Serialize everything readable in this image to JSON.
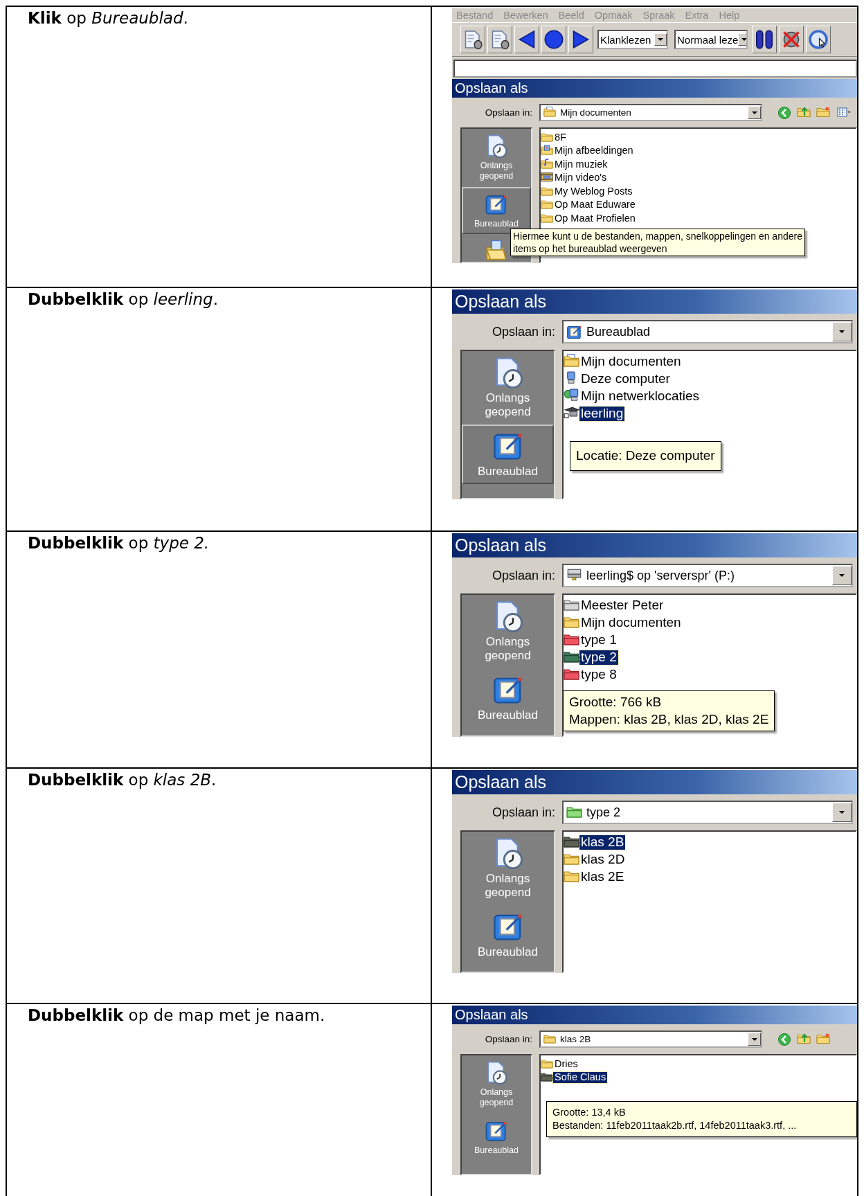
{
  "steps": [
    {
      "instruction": "**Klik** op *Bureaublad*.",
      "screenshot": {
        "kind": "compact",
        "menu": [
          "Bestand",
          "Bewerken",
          "Beeld",
          "Opmaak",
          "Spraak",
          "Extra",
          "Help"
        ],
        "toolbar": [
          {
            "kind": "speaker"
          },
          {
            "kind": "speaker"
          },
          {
            "kind": "prev"
          },
          {
            "kind": "stop"
          },
          {
            "kind": "next"
          },
          {
            "kind": "dropdown",
            "value": "Klanklezen"
          },
          {
            "kind": "dropdown",
            "value": "Normaal leze"
          },
          {
            "kind": "pause"
          },
          {
            "kind": "mute"
          },
          {
            "kind": "clock"
          }
        ],
        "text_field": true,
        "title": "Opslaan als",
        "location_label": "Opslaan in:",
        "location": {
          "name": "Mijn documenten",
          "kind": "documents"
        },
        "nav_buttons": [
          {
            "kind": "back"
          },
          {
            "kind": "up"
          },
          {
            "kind": "newfolder"
          },
          {
            "kind": "views"
          }
        ],
        "places": [
          {
            "label": "Onlangs geopend",
            "kind": "recent",
            "selected": false
          },
          {
            "label": "Bureaublad",
            "kind": "desktop",
            "selected": true
          },
          {
            "kind": "openfolder",
            "selected": false
          }
        ],
        "files": [
          {
            "name": "8F",
            "kind": "folder",
            "selected": false
          },
          {
            "name": "Mijn afbeeldingen",
            "kind": "pictures",
            "selected": false
          },
          {
            "name": "Mijn muziek",
            "kind": "music",
            "selected": false
          },
          {
            "name": "Mijn video's",
            "kind": "video",
            "selected": false
          },
          {
            "name": "My Weblog Posts",
            "kind": "folder",
            "selected": false
          },
          {
            "name": "Op Maat Eduware",
            "kind": "folder",
            "selected": false
          },
          {
            "name": "Op Maat Profielen",
            "kind": "folder",
            "selected": false
          }
        ],
        "tooltip": [
          "Hiermee kunt u de bestanden, mappen, snelkoppelingen en andere",
          "items op het bureaublad weergeven"
        ]
      }
    },
    {
      "instruction": "**Dubbelklik** op *leerling*.",
      "screenshot": {
        "kind": "large",
        "title": "Opslaan als",
        "location_label": "Opslaan in:",
        "location": {
          "name": "Bureaublad",
          "kind": "desktop"
        },
        "places": [
          {
            "label": "Onlangs geopend",
            "kind": "recent",
            "selected": false
          },
          {
            "label": "Bureaublad",
            "kind": "desktop",
            "selected": true
          }
        ],
        "files": [
          {
            "name": "Mijn documenten",
            "kind": "documents",
            "selected": false
          },
          {
            "name": "Deze computer",
            "kind": "computer",
            "selected": false
          },
          {
            "name": "Mijn netwerklocaties",
            "kind": "network",
            "selected": false
          },
          {
            "name": "leerling",
            "kind": "share",
            "selected": true
          }
        ],
        "tooltip": [
          "Locatie: Deze computer"
        ]
      }
    },
    {
      "instruction": "**Dubbelklik** op *type 2.*",
      "screenshot": {
        "kind": "large",
        "title": "Opslaan als",
        "location_label": "Opslaan in:",
        "location": {
          "name": "leerling$ op 'serverspr' (P:)",
          "kind": "drive"
        },
        "places": [
          {
            "label": "Onlangs geopend",
            "kind": "recent",
            "selected": false
          },
          {
            "label": "Bureaublad",
            "kind": "desktop",
            "selected": false
          }
        ],
        "files": [
          {
            "name": "Meester Peter",
            "kind": "greyfolder",
            "selected": false
          },
          {
            "name": "Mijn documenten",
            "kind": "folder",
            "selected": false
          },
          {
            "name": "type 1",
            "kind": "redfolder",
            "selected": false
          },
          {
            "name": "type 2",
            "kind": "greenfolder",
            "selected": true
          },
          {
            "name": "type 8",
            "kind": "redfolder",
            "selected": false
          }
        ],
        "tooltip": [
          "Grootte: 766 kB",
          "Mappen: klas 2B, klas 2D, klas 2E"
        ]
      }
    },
    {
      "instruction": "**Dubbelklik** op *klas 2B*.",
      "screenshot": {
        "kind": "large",
        "title": "Opslaan als",
        "location_label": "Opslaan in:",
        "location": {
          "name": "type 2",
          "kind": "lightgreenfolder"
        },
        "places": [
          {
            "label": "Onlangs geopend",
            "kind": "recent",
            "selected": false
          },
          {
            "label": "Bureaublad",
            "kind": "desktop",
            "selected": false
          }
        ],
        "files": [
          {
            "name": "klas 2B",
            "kind": "darkfolder",
            "selected": true
          },
          {
            "name": "klas 2D",
            "kind": "folder",
            "selected": false
          },
          {
            "name": "klas 2E",
            "kind": "folder",
            "selected": false
          }
        ]
      }
    },
    {
      "instruction": "**Dubbelklik** op de map met je naam.",
      "screenshot": {
        "kind": "compact",
        "title": "Opslaan als",
        "location_label": "Opslaan in:",
        "location": {
          "name": "klas 2B",
          "kind": "folder"
        },
        "nav_buttons": [
          {
            "kind": "back"
          },
          {
            "kind": "up"
          },
          {
            "kind": "newfolder"
          }
        ],
        "places": [
          {
            "label": "Onlangs geopend",
            "kind": "recent",
            "selected": false
          },
          {
            "label": "Bureaublad",
            "kind": "desktop",
            "selected": false
          }
        ],
        "files": [
          {
            "name": "Dries",
            "kind": "folder",
            "selected": false
          },
          {
            "name": "Sofie Claus",
            "kind": "darkfolder",
            "selected": true
          }
        ],
        "tooltip": [
          "Grootte: 13,4 kB",
          "Bestanden: 11feb2011taak2b.rtf, 14feb2011taak3.rtf, ..."
        ]
      }
    }
  ]
}
